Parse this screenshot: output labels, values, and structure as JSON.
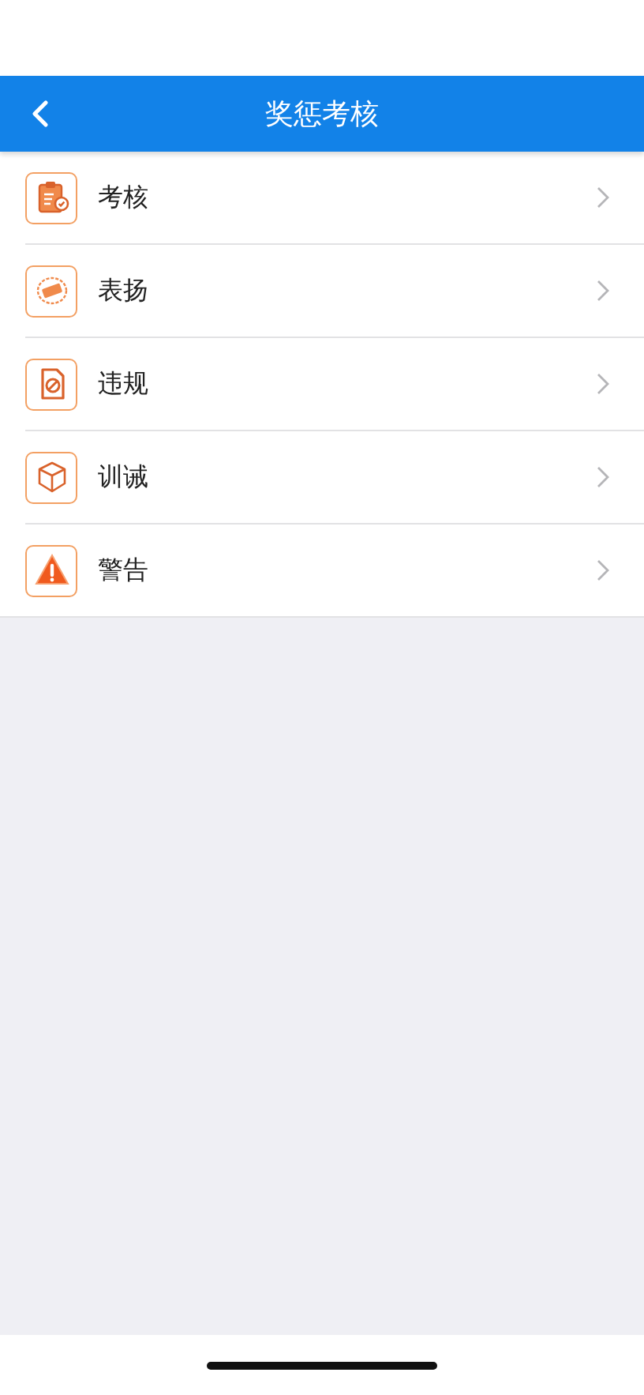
{
  "header": {
    "title": "奖惩考核"
  },
  "menu": [
    {
      "label": "考核"
    },
    {
      "label": "表扬"
    },
    {
      "label": "违规"
    },
    {
      "label": "训诫"
    },
    {
      "label": "警告"
    }
  ]
}
